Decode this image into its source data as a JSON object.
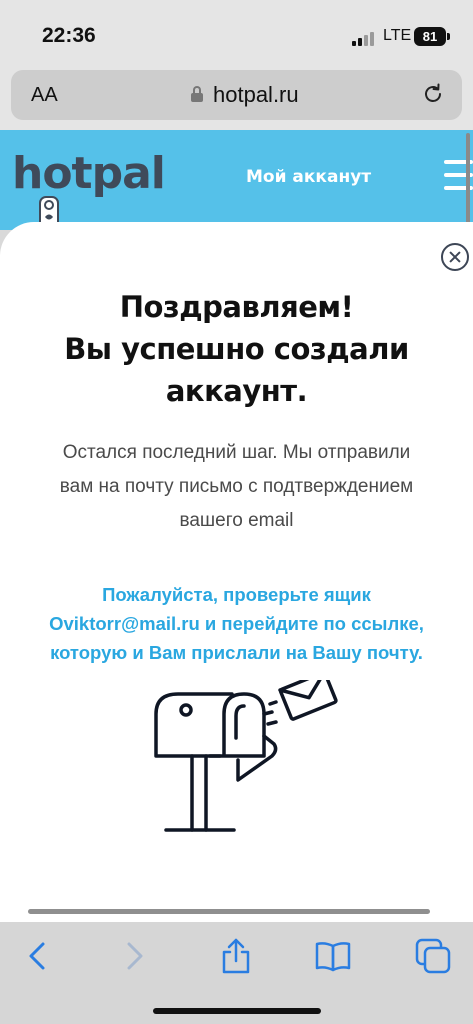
{
  "status_bar": {
    "time": "22:36",
    "network": "LTE",
    "battery": "81"
  },
  "browser": {
    "text_size_label": "AA",
    "url": "hotpal.ru",
    "icons": [
      "lock-icon",
      "reload-icon",
      "back-icon",
      "forward-icon",
      "share-icon",
      "bookmarks-icon",
      "tabs-icon"
    ]
  },
  "site": {
    "logo": "hotpal",
    "account_link": "Мой акканут",
    "brand_color": "#55c1e9",
    "accent_color": "#2aa7e0"
  },
  "modal": {
    "title_line1": "Поздравляем!",
    "title_line2": "Вы успешно создали",
    "title_line3": "аккаунт.",
    "subtitle_line1": "Остался последний шаг. Мы отправили",
    "subtitle_line2": "вам на почту письмо с подтверждением",
    "subtitle_line3": "вашего email",
    "notice_line1": "Пожалуйста, проверьте ящик",
    "notice_line2": "Oviktorr@mail.ru и перейдите по ссылке,",
    "notice_line3": "которую и Вам прислали на Вашу почту.",
    "illustration": "mailbox-icon"
  }
}
